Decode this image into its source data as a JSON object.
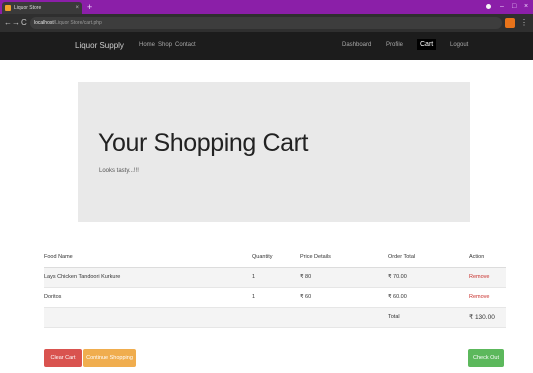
{
  "browser": {
    "tab_title": "Liquor Store",
    "tab_close": "×",
    "new_tab": "+",
    "url_host": "localhost",
    "url_path": "/Liquor Store/cart.php",
    "back": "←",
    "forward": "→",
    "reload": "C",
    "menu": "⋮",
    "win_min": "–",
    "win_max": "□",
    "win_close": "×",
    "colors": {
      "tabbar": "#8b1fa8",
      "toolbar": "#2f2f2f"
    }
  },
  "navbar": {
    "brand": "Liquor Supply",
    "links": [
      "Home",
      "Shop",
      "Contact"
    ],
    "right_links": [
      "Dashboard",
      "Profile",
      "Cart",
      "Logout"
    ],
    "active_link": "Cart"
  },
  "jumbotron": {
    "title": "Your Shopping Cart",
    "subtitle": "Looks tasty...!!!"
  },
  "cart": {
    "headers": [
      "Food Name",
      "Quantity",
      "Price Details",
      "Order Total",
      "Action"
    ],
    "rows": [
      {
        "name": "Lays Chicken Tandoori Kurkure",
        "quantity": "1",
        "price": "₹ 80",
        "total": "₹ 70.00",
        "action": "Remove"
      },
      {
        "name": "Doritos",
        "quantity": "1",
        "price": "₹ 60",
        "total": "₹ 60.00",
        "action": "Remove"
      }
    ],
    "total_label": "Total",
    "total_value": "₹ 130.00"
  },
  "buttons": {
    "clear": "Clear Cart",
    "continue": "Continue Shopping",
    "checkout": "Check Out"
  },
  "colors": {
    "clear": "#d9534f",
    "continue": "#f0ad4e",
    "checkout": "#5cb85c",
    "remove": "#c9302c"
  }
}
